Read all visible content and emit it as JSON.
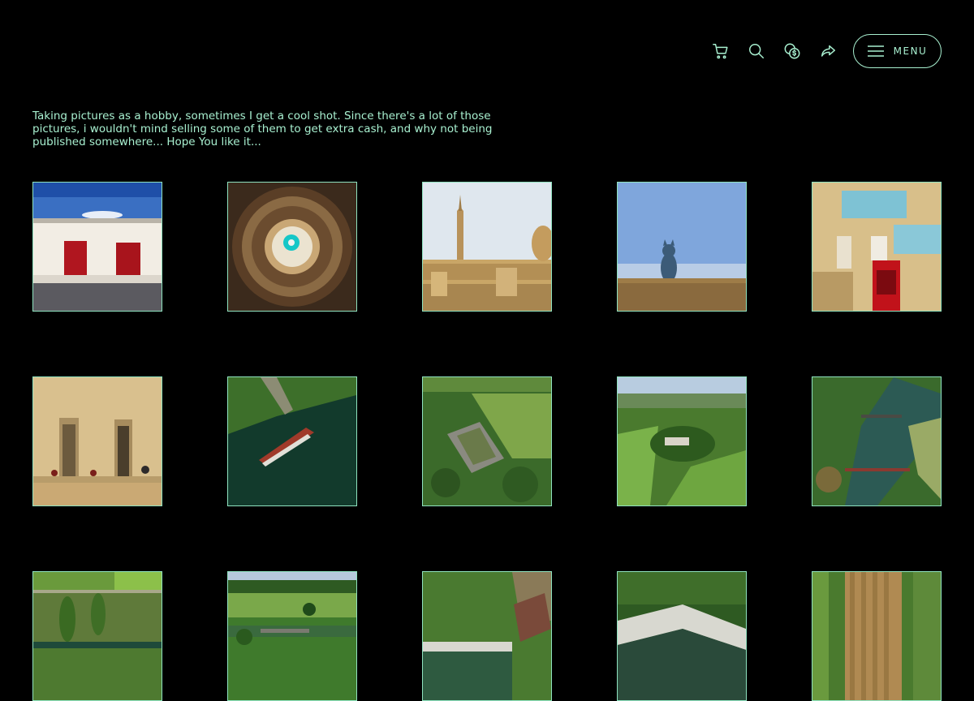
{
  "header": {
    "icons": [
      "cart-icon",
      "search-icon",
      "currency-icon",
      "share-icon",
      "menu-icon"
    ],
    "menu_label": "MENU"
  },
  "intro": {
    "text": "Taking pictures as a hobby, sometimes I get a cool shot. Since there's a lot of those pictures, i wouldn't mind selling some of them to get extra cash, and why not being published somewhere... Hope You like it..."
  },
  "colors": {
    "accent": "#a8f0d0",
    "background": "#000000"
  },
  "gallery": [
    {
      "subject": "building-with-red-doors"
    },
    {
      "subject": "ornate-dome-ceiling"
    },
    {
      "subject": "city-skyline-with-spire"
    },
    {
      "subject": "cat-statue-on-wall"
    },
    {
      "subject": "balconies-and-red-phone-box"
    },
    {
      "subject": "sandstone-facade-with-balcony"
    },
    {
      "subject": "aerial-boat-on-river"
    },
    {
      "subject": "aerial-castle-ruins"
    },
    {
      "subject": "aerial-hilltop-castle"
    },
    {
      "subject": "aerial-river-with-bridges"
    },
    {
      "subject": "aerial-trees-and-fields"
    },
    {
      "subject": "river-with-stone-bridge"
    },
    {
      "subject": "aerial-building-by-weir"
    },
    {
      "subject": "aerial-waterfall-forest"
    },
    {
      "subject": "aerial-striped-fields"
    }
  ]
}
